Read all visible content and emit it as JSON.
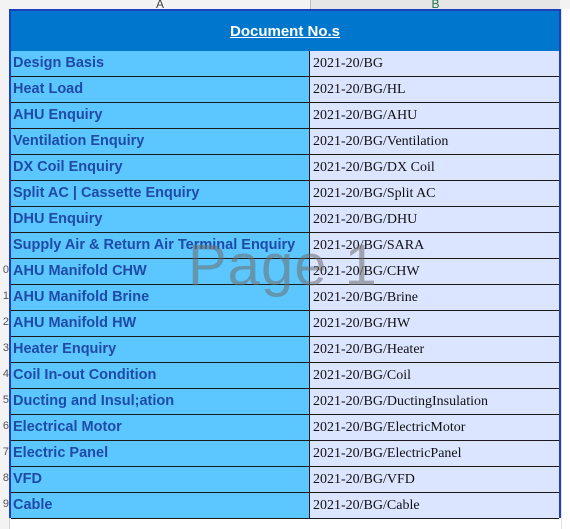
{
  "columns": {
    "a": "A",
    "b": "B"
  },
  "row_numbers": [
    "",
    "",
    "",
    "",
    "",
    "",
    "",
    "",
    "",
    "0",
    "1",
    "2",
    "3",
    "4",
    "5",
    "6",
    "7",
    "8",
    "9"
  ],
  "title": "Document No.s",
  "watermark": "Page 1",
  "rows": [
    {
      "label": "Design Basis",
      "doc": "2021-20/BG"
    },
    {
      "label": "Heat Load",
      "doc": "2021-20/BG/HL"
    },
    {
      "label": "AHU Enquiry",
      "doc": "2021-20/BG/AHU"
    },
    {
      "label": "Ventilation Enquiry",
      "doc": "2021-20/BG/Ventilation"
    },
    {
      "label": "DX Coil Enquiry",
      "doc": "2021-20/BG/DX Coil"
    },
    {
      "label": "Split AC | Cassette Enquiry",
      "doc": "2021-20/BG/Split AC"
    },
    {
      "label": "DHU Enquiry",
      "doc": "2021-20/BG/DHU"
    },
    {
      "label": "Supply Air & Return Air Terminal Enquiry",
      "doc": "2021-20/BG/SARA"
    },
    {
      "label": "AHU Manifold CHW",
      "doc": "2021-20/BG/CHW"
    },
    {
      "label": "AHU Manifold Brine",
      "doc": "2021-20/BG/Brine"
    },
    {
      "label": "AHU Manifold HW",
      "doc": "2021-20/BG/HW"
    },
    {
      "label": "Heater Enquiry",
      "doc": "2021-20/BG/Heater"
    },
    {
      "label": "Coil In-out Condition",
      "doc": "2021-20/BG/Coil"
    },
    {
      "label": "Ducting and Insul;ation",
      "doc": "2021-20/BG/DuctingInsulation"
    },
    {
      "label": "Electrical Motor",
      "doc": "2021-20/BG/ElectricMotor"
    },
    {
      "label": "Electric Panel",
      "doc": "2021-20/BG/ElectricPanel"
    },
    {
      "label": "VFD",
      "doc": "2021-20/BG/VFD"
    },
    {
      "label": "Cable",
      "doc": "2021-20/BG/Cable"
    }
  ]
}
